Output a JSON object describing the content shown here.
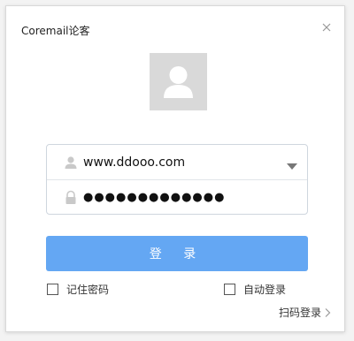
{
  "window": {
    "title": "Coremail论客"
  },
  "account": {
    "username": "www.ddooo.com",
    "password_mask": "●●●●●●●●●●●●●"
  },
  "actions": {
    "login_label": "登 录",
    "remember_password_label": "记住密码",
    "auto_login_label": "自动登录",
    "qr_login_label": "扫码登录"
  },
  "state": {
    "remember_password": false,
    "auto_login": false
  },
  "colors": {
    "accent": "#64a7f3",
    "avatar_bg": "#d9d9d9",
    "icon_gray": "#cccccc",
    "border": "#cfd6de"
  },
  "icons": {
    "close": "close-icon",
    "avatar": "user-avatar-icon",
    "user": "user-icon",
    "lock": "lock-icon",
    "dropdown": "caret-down-icon",
    "arrow": "chevron-right-icon"
  }
}
